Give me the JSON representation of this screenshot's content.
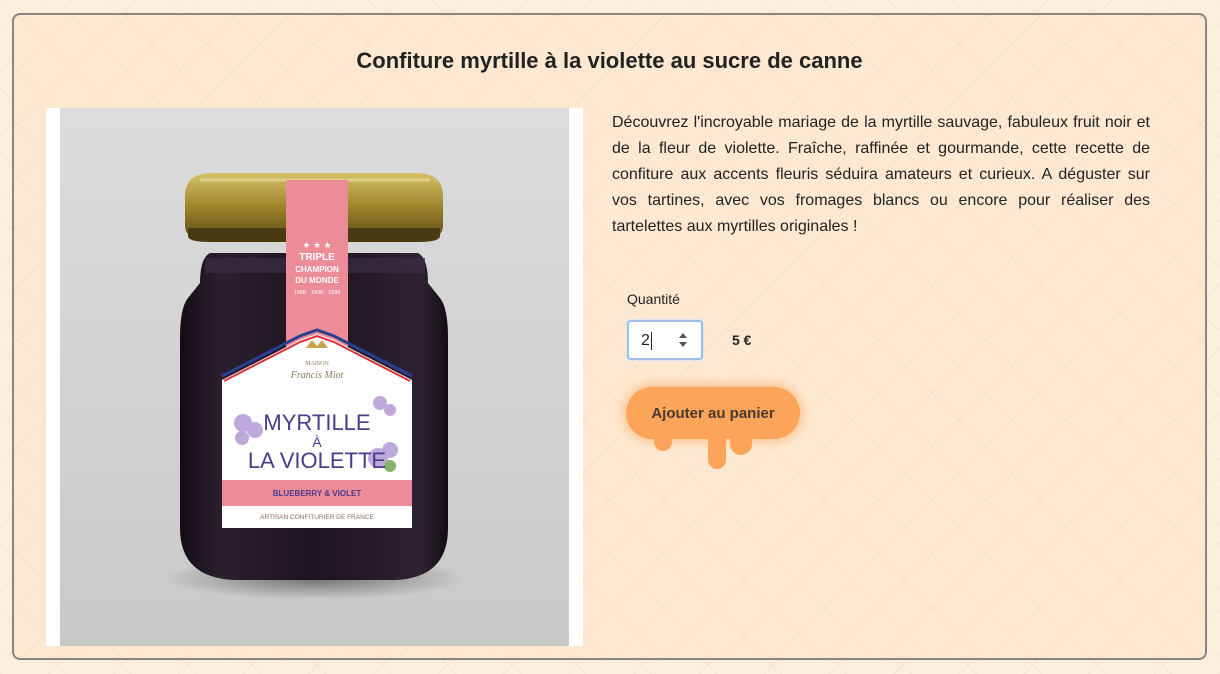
{
  "product": {
    "title": "Confiture myrtille à la violette au sucre de canne",
    "description": "Découvrez l'incroyable mariage de la myrtille sauvage, fabuleux fruit noir et de la fleur de violette. Fraîche, raffinée et gourmande, cette recette de confiture aux accents fleuris séduira amateurs et curieux. A déguster sur vos tartines, avec vos fromages blancs ou encore pour réaliser des tartelettes aux myrtilles originales !",
    "image": {
      "label": {
        "seal_stars": "★ ★ ★",
        "seal_line1": "TRIPLE",
        "seal_line2": "CHAMPION",
        "seal_line3": "DU MONDE",
        "seal_years": "1988 · 1990 · 1993",
        "brand_top": "MAISON",
        "brand_name": "Francis Miot",
        "name_line1": "MYRTILLE",
        "name_line2": "À",
        "name_line3": "LA VIOLETTE",
        "subtitle": "BLUEBERRY & VIOLET",
        "footer": "ARTISAN CONFITURIER DE FRANCE"
      }
    }
  },
  "purchase": {
    "quantity_label": "Quantité",
    "quantity_value": "2",
    "price": "5 €",
    "add_to_cart_label": "Ajouter au panier"
  },
  "colors": {
    "page_background": "#fbefde",
    "card_background": "#fde9d1",
    "button": "#fca55a",
    "label_pink": "#ec8c98",
    "jam": "#221724",
    "lid_gold": "#b29a3a"
  },
  "icons": [
    "stepper-up-icon",
    "stepper-down-icon"
  ]
}
